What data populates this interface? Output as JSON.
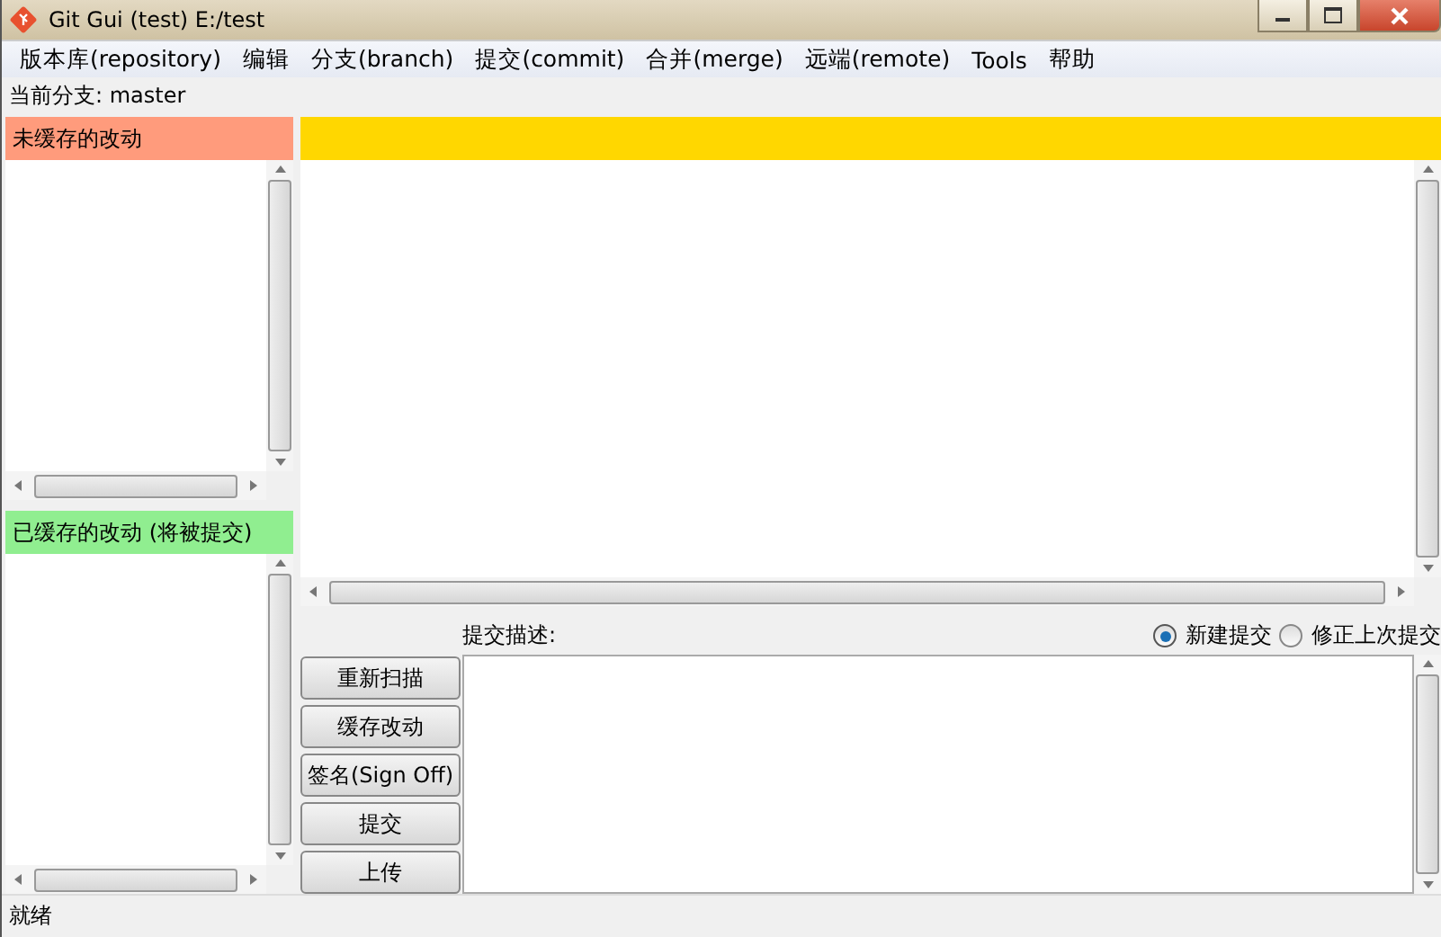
{
  "window": {
    "title": "Git Gui (test) E:/test"
  },
  "menu": [
    "版本库(repository)",
    "编辑",
    "分支(branch)",
    "提交(commit)",
    "合并(merge)",
    "远端(remote)",
    "Tools",
    "帮助"
  ],
  "current_branch": "当前分支: master",
  "unstaged": {
    "title": "未缓存的改动"
  },
  "staged": {
    "title": "已缓存的改动 (将被提交)"
  },
  "commit": {
    "label": "提交描述:",
    "modes": [
      {
        "label": "新建提交",
        "selected": true
      },
      {
        "label": "修正上次提交",
        "selected": false
      }
    ],
    "buttons": [
      "重新扫描",
      "缓存改动",
      "签名(Sign Off)",
      "提交",
      "上传"
    ]
  },
  "status_bar": "就绪"
}
